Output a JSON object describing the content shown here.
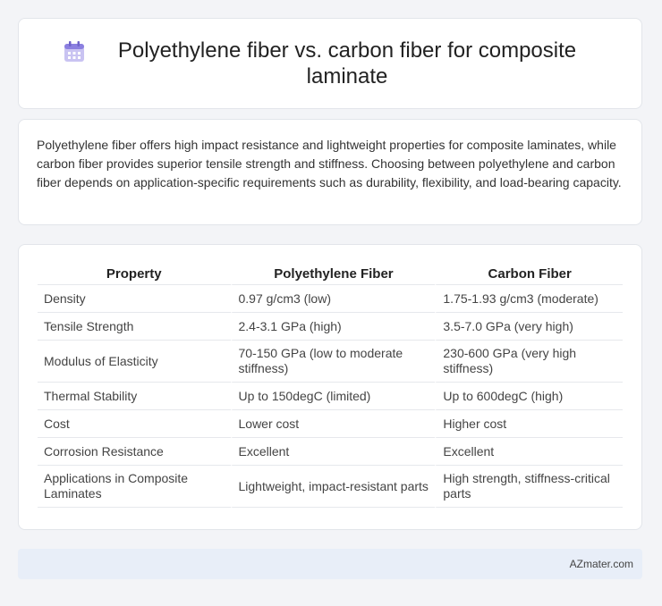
{
  "header": {
    "title": "Polyethylene fiber vs. carbon fiber for composite laminate",
    "icon": "calendar-icon"
  },
  "summary": {
    "text": "Polyethylene fiber offers high impact resistance and lightweight properties for composite laminates, while carbon fiber provides superior tensile strength and stiffness. Choosing between polyethylene and carbon fiber depends on application-specific requirements such as durability, flexibility, and load-bearing capacity."
  },
  "table": {
    "headers": [
      "Property",
      "Polyethylene Fiber",
      "Carbon Fiber"
    ],
    "rows": [
      [
        "Density",
        "0.97 g/cm3 (low)",
        "1.75-1.93 g/cm3 (moderate)"
      ],
      [
        "Tensile Strength",
        "2.4-3.1 GPa (high)",
        "3.5-7.0 GPa (very high)"
      ],
      [
        "Modulus of Elasticity",
        "70-150 GPa (low to moderate stiffness)",
        "230-600 GPa (very high stiffness)"
      ],
      [
        "Thermal Stability",
        "Up to 150degC (limited)",
        "Up to 600degC (high)"
      ],
      [
        "Cost",
        "Lower cost",
        "Higher cost"
      ],
      [
        "Corrosion Resistance",
        "Excellent",
        "Excellent"
      ],
      [
        "Applications in Composite Laminates",
        "Lightweight, impact-resistant parts",
        "High strength, stiffness-critical parts"
      ]
    ]
  },
  "footer": {
    "text": "AZmater.com"
  },
  "colors": {
    "background": "#f3f4f7",
    "card": "#ffffff",
    "footer_bg": "#e8eef8",
    "icon_accent": "#7b6fd6"
  }
}
